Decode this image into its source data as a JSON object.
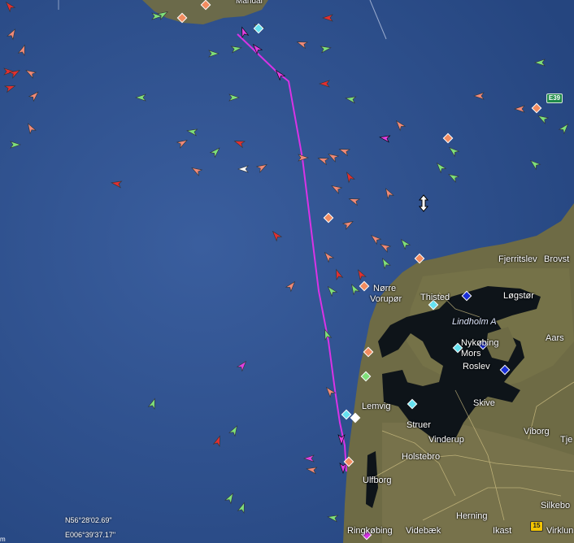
{
  "map": {
    "colors": {
      "sea": "#2e4f8c",
      "land": "#6d6a3f",
      "track": "#d933e6",
      "vessel_cargo": "#7fe07a",
      "vessel_tanker": "#e23030",
      "vessel_passenger": "#f08a78",
      "vessel_other": "#e040e0",
      "station_orange": "#f28c60",
      "station_cyan": "#66e2f0",
      "station_blue": "#1a2fd8"
    },
    "places": [
      {
        "name": "Fjerritslev",
        "style": "normal"
      },
      {
        "name": "Brovst",
        "style": "normal"
      },
      {
        "name": "Nørre",
        "style": "normal"
      },
      {
        "name": "Vorupør",
        "style": "normal"
      },
      {
        "name": "Thisted",
        "style": "normal"
      },
      {
        "name": "Løgstør",
        "style": "normal"
      },
      {
        "name": "Lindholm A",
        "style": "italic"
      },
      {
        "name": "Aars",
        "style": "normal"
      },
      {
        "name": "Nykøbing",
        "style": "normal"
      },
      {
        "name": "Mors",
        "style": "normal"
      },
      {
        "name": "Roslev",
        "style": "normal"
      },
      {
        "name": "Skive",
        "style": "normal"
      },
      {
        "name": "Lemvig",
        "style": "normal"
      },
      {
        "name": "Struer",
        "style": "normal"
      },
      {
        "name": "Vinderup",
        "style": "normal"
      },
      {
        "name": "Viborg",
        "style": "normal"
      },
      {
        "name": "Tje",
        "style": "normal"
      },
      {
        "name": "Holstebro",
        "style": "normal"
      },
      {
        "name": "Ulfborg",
        "style": "normal"
      },
      {
        "name": "Herning",
        "style": "normal"
      },
      {
        "name": "Silkebo",
        "style": "normal"
      },
      {
        "name": "Ringkøbing",
        "style": "normal"
      },
      {
        "name": "Videbæk",
        "style": "normal"
      },
      {
        "name": "Ikast",
        "style": "normal"
      },
      {
        "name": "Virklun",
        "style": "normal"
      },
      {
        "name": "Mandal",
        "style": "top"
      }
    ],
    "road_shields": [
      {
        "label": "E39",
        "style": "green"
      },
      {
        "label": "15",
        "style": "yellow"
      }
    ],
    "coordinates": {
      "latitude": "N56°28'02.69\"",
      "longitude": "E006°39'37.17\""
    },
    "scale_label": "m"
  }
}
